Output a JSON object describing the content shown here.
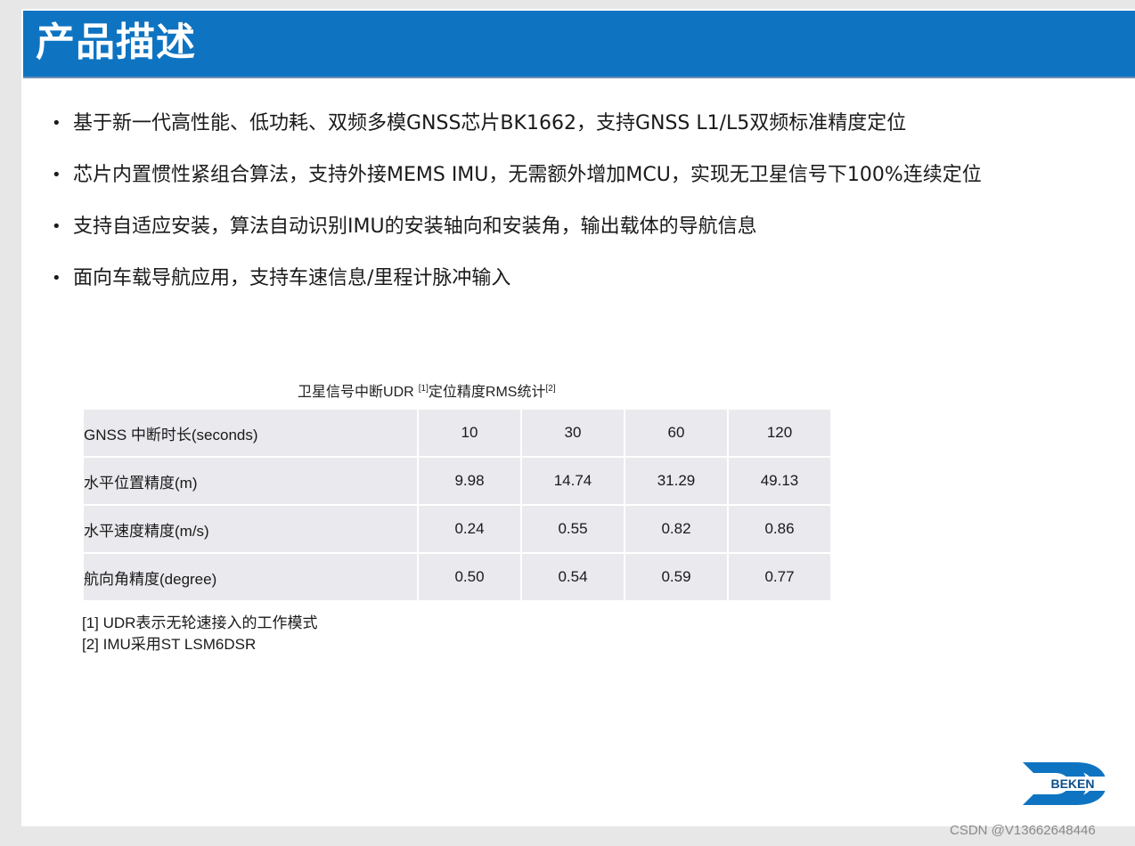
{
  "title": "产品描述",
  "bullets": [
    "基于新一代高性能、低功耗、双频多模GNSS芯片BK1662，支持GNSS L1/L5双频标准精度定位",
    "芯片内置惯性紧组合算法，支持外接MEMS IMU，无需额外增加MCU，实现无卫星信号下100%连续定位",
    "支持自适应安装，算法自动识别IMU的安装轴向和安装角，输出载体的导航信息",
    "面向车载导航应用，支持车速信息/里程计脉冲输入"
  ],
  "table": {
    "caption": {
      "part1": "卫星信号中断",
      "udr": "UDR",
      "ref1": "[1]",
      "part2": "定位精度",
      "rms": "RMS",
      "part3": "统计",
      "ref2": "[2]"
    },
    "rows": [
      {
        "label": "GNSS 中断时长(seconds)",
        "values": [
          "10",
          "30",
          "60",
          "120"
        ]
      },
      {
        "label": "水平位置精度(m)",
        "values": [
          "9.98",
          "14.74",
          "31.29",
          "49.13"
        ]
      },
      {
        "label": "水平速度精度(m/s)",
        "values": [
          "0.24",
          "0.55",
          "0.82",
          "0.86"
        ]
      },
      {
        "label": "航向角精度(degree)",
        "values": [
          "0.50",
          "0.54",
          "0.59",
          "0.77"
        ]
      }
    ]
  },
  "footnotes": [
    {
      "prefix": "[1] UDR",
      "text": "表示无轮速接入的工作模式"
    },
    {
      "prefix": "[2] IMU",
      "text": "采用",
      "suffix": "ST LSM6DSR"
    }
  ],
  "logo": {
    "text": "BEKEN",
    "color": "#0e74c2",
    "icon": "beken-logo-icon"
  },
  "watermark": "CSDN @V13662648446",
  "colors": {
    "title_bar": "#0e74c2",
    "table_cell": "#e9e9ee"
  }
}
